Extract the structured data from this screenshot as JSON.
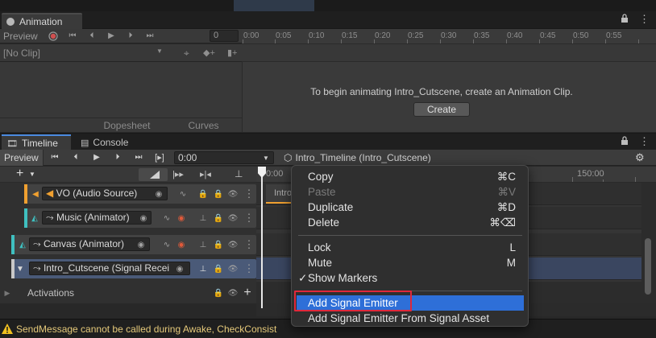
{
  "animation": {
    "tab_title": "Animation",
    "preview_label": "Preview",
    "frame_value": "0",
    "clip_select": "[No Clip]",
    "message": "To begin animating Intro_Cutscene, create an Animation Clip.",
    "create_label": "Create",
    "bottom_tabs": [
      "Dopesheet",
      "Curves"
    ],
    "ruler_ticks": [
      "0:00",
      "0:05",
      "0:10",
      "0:15",
      "0:20",
      "0:25",
      "0:30",
      "0:35",
      "0:40",
      "0:45",
      "0:50",
      "0:55"
    ]
  },
  "timeline": {
    "tabs": [
      "Timeline",
      "Console"
    ],
    "preview_label": "Preview",
    "time_value": "0:00",
    "asset_label": "Intro_Timeline (Intro_Cutscene)",
    "ruler_ticks": [
      "0:00",
      "150:00"
    ],
    "clip_label": "Intro",
    "tracks": [
      {
        "name": "VO (Audio Source)",
        "color": "#f0a030"
      },
      {
        "name": "Music (Animator)",
        "color": "#3fc0c0"
      },
      {
        "name": "Canvas (Animator)",
        "color": "#3fc0c0"
      },
      {
        "name": "Intro_Cutscene (Signal Recei",
        "color": "#c8c8c8"
      }
    ],
    "activations_label": "Activations"
  },
  "context_menu": {
    "items": [
      {
        "label": "Copy",
        "shortcut": "⌘C",
        "enabled": true
      },
      {
        "label": "Paste",
        "shortcut": "⌘V",
        "enabled": false
      },
      {
        "label": "Duplicate",
        "shortcut": "⌘D",
        "enabled": true
      },
      {
        "label": "Delete",
        "shortcut": "⌘⌫",
        "enabled": true
      },
      {
        "label": "Lock",
        "shortcut": "L",
        "enabled": true
      },
      {
        "label": "Mute",
        "shortcut": "M",
        "enabled": true
      },
      {
        "label": "Show Markers",
        "shortcut": "",
        "enabled": true,
        "checked": true
      },
      {
        "label": "Add Signal Emitter",
        "shortcut": "",
        "enabled": true,
        "highlighted": true
      },
      {
        "label": "Add Signal Emitter From Signal Asset",
        "shortcut": "",
        "enabled": true
      }
    ],
    "check_glyph": "✓"
  },
  "status": {
    "message": "SendMessage cannot be called during Awake, CheckConsist",
    "warning_color": "#f0c020"
  },
  "colors": {
    "highlight": "#2e6fd8",
    "annotation_box": "#e0283a",
    "panel_bg": "#383838"
  }
}
